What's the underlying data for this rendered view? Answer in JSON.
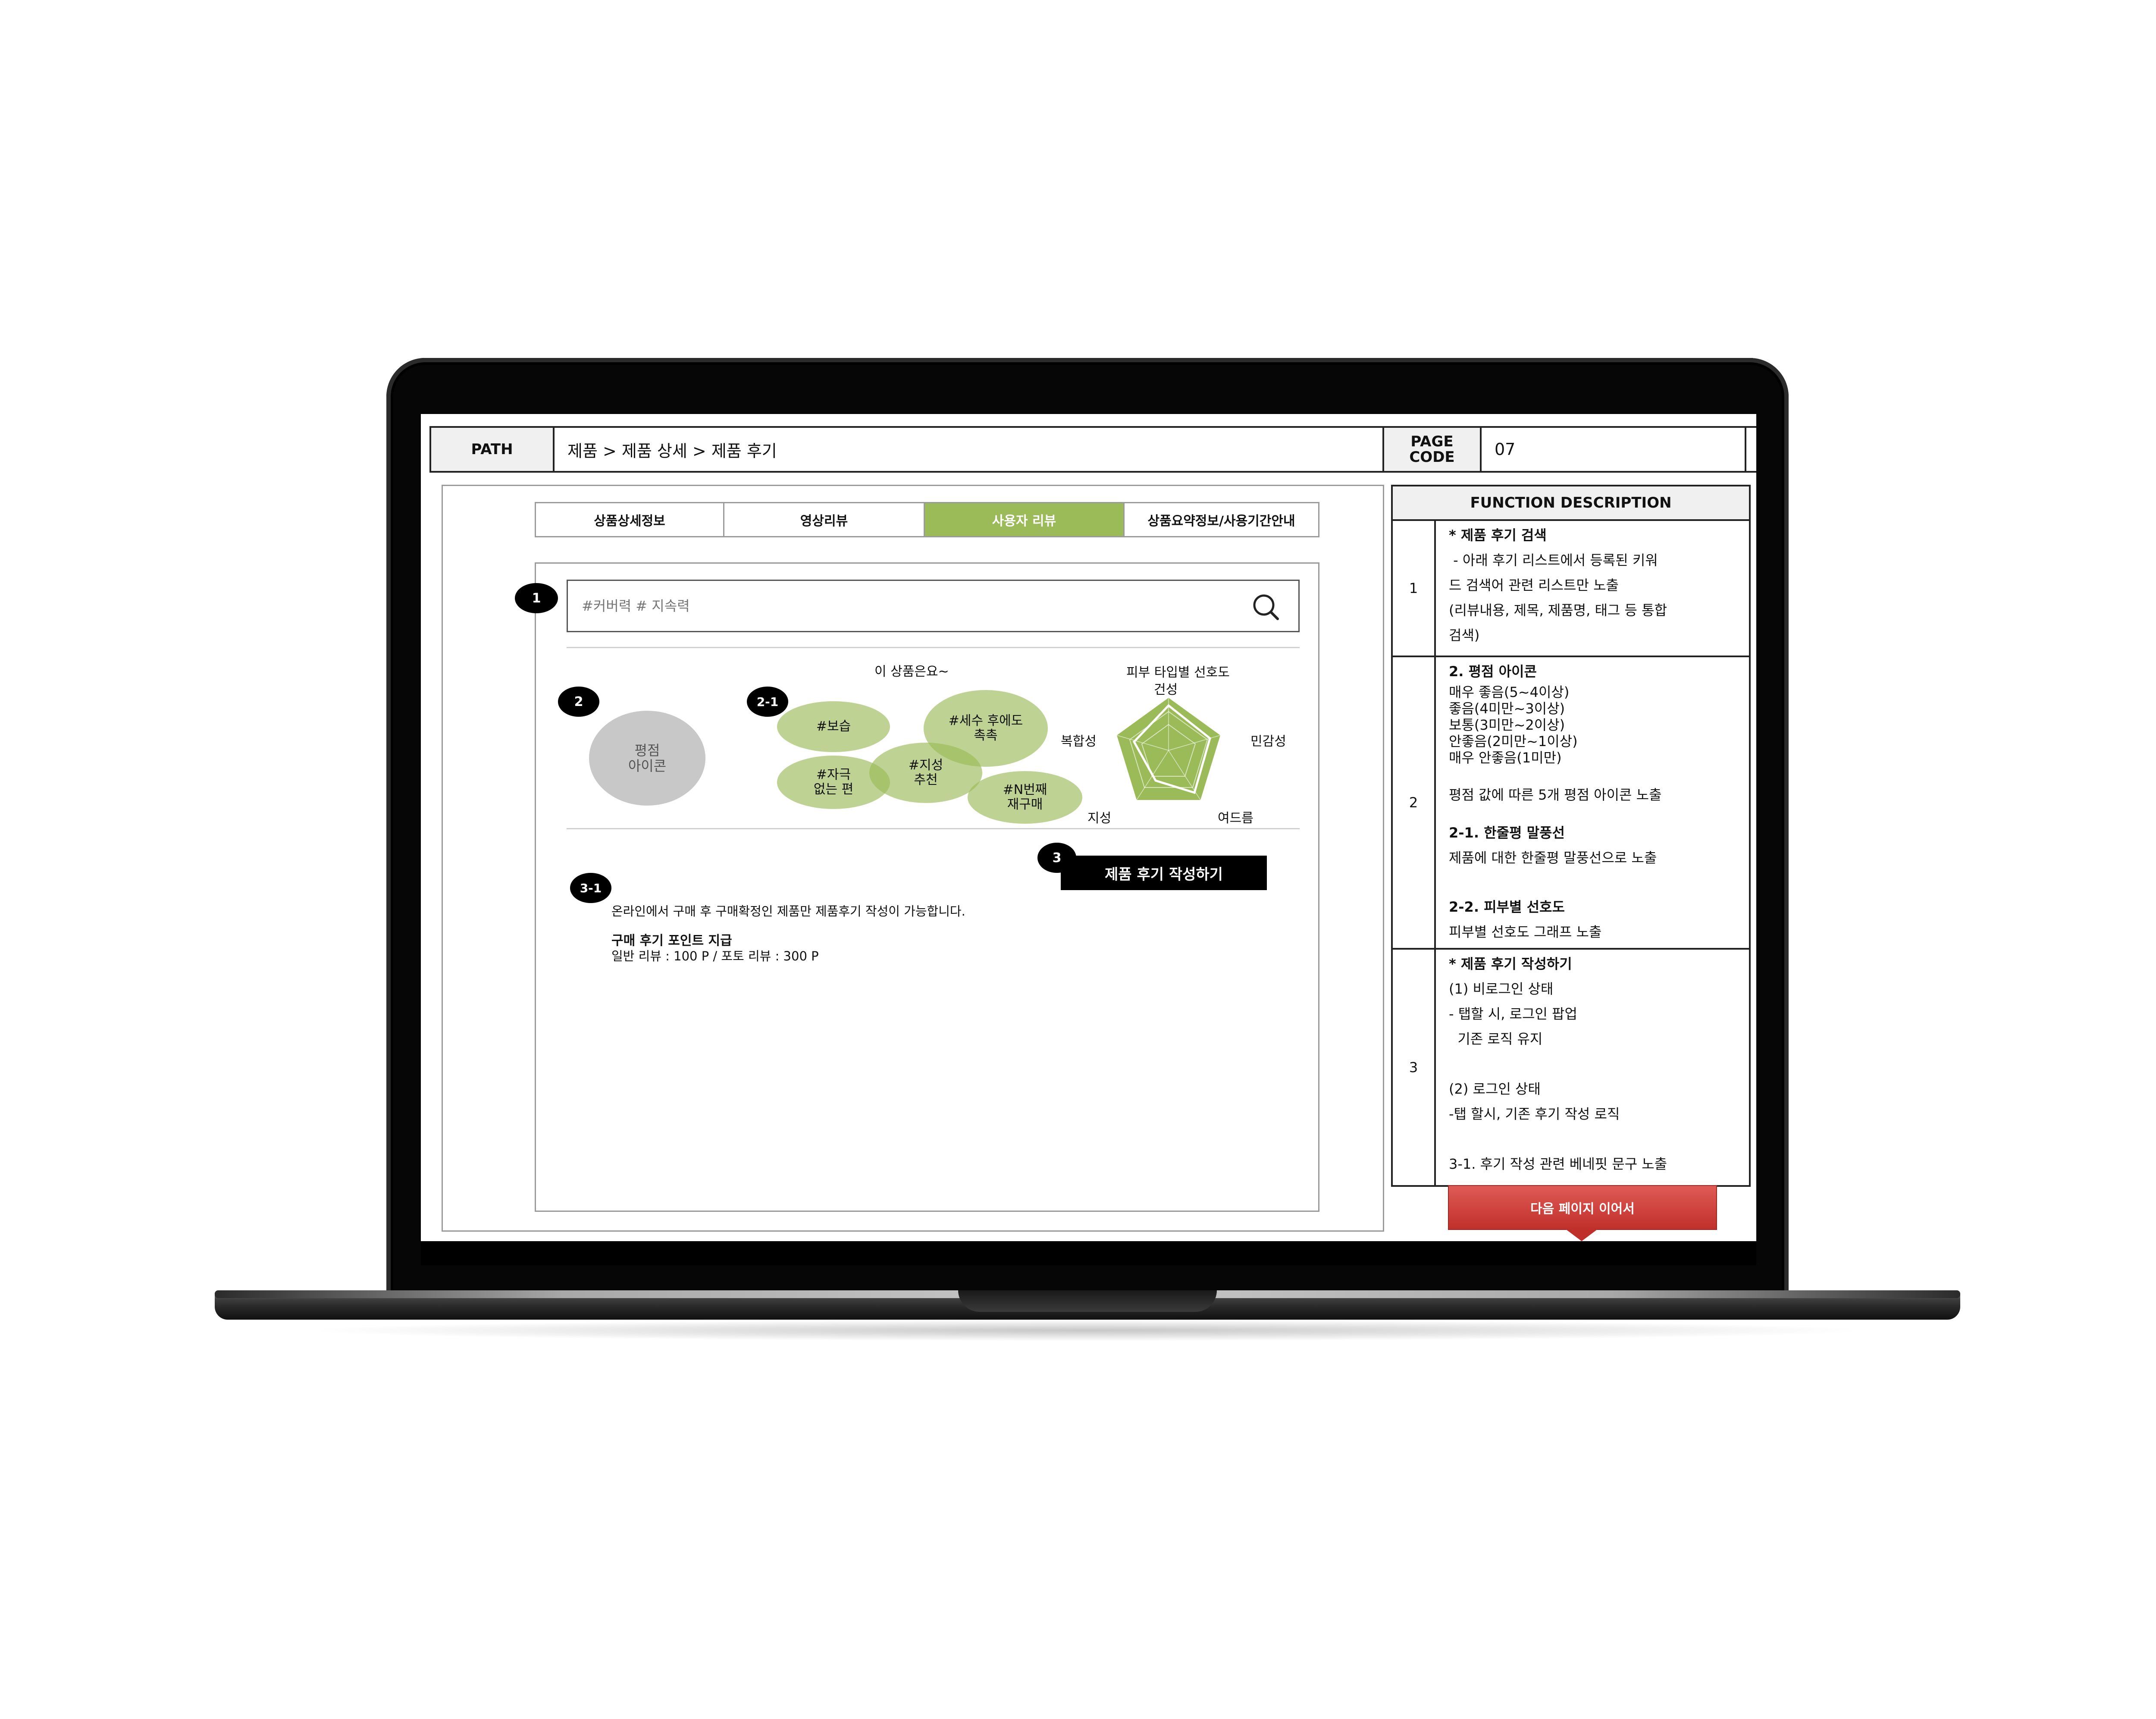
{
  "header": {
    "path_label": "PATH",
    "path_value": "제품 > 제품 상세 > 제품 후기",
    "page_code_label": "PAGE\nCODE",
    "page_code_value": "07"
  },
  "tabs": [
    {
      "label": "상품상세정보"
    },
    {
      "label": "영상리뷰"
    },
    {
      "label": "사용자 리뷰"
    },
    {
      "label": "상품요약정보/사용기간안내"
    }
  ],
  "search": {
    "placeholder": "#커버력 # 지속력",
    "icon": "search-icon"
  },
  "markers": {
    "m1": "1",
    "m2": "2",
    "m2_1": "2-1",
    "m3": "3",
    "m3_1": "3-1"
  },
  "rating_icon": {
    "label": "평점\n아이콘"
  },
  "bubbles": {
    "title": "이 상품은요~",
    "items": [
      {
        "label": "#보습"
      },
      {
        "label": "#세수 후에도\n촉촉"
      },
      {
        "label": "#자극\n없는 편"
      },
      {
        "label": "#지성\n추천"
      },
      {
        "label": "#N번째\n재구매"
      }
    ]
  },
  "radar": {
    "title": "피부 타입별 선호도",
    "axes": [
      "건성",
      "민감성",
      "여드름",
      "지성",
      "복합성"
    ],
    "accent": "#9bbb59"
  },
  "write_review_button": "제품 후기 작성하기",
  "notice": {
    "text": "온라인에서 구매 후 구매확정인 제품만 제품후기 작성이 가능합니다.",
    "points_title": "구매 후기 포인트 지급",
    "points_detail": "일반 리뷰 : 100 P / 포토 리뷰 : 300 P"
  },
  "function_description": {
    "title": "FUNCTION DESCRIPTION",
    "rows": [
      {
        "num": "1",
        "lines": [
          "* 제품 후기 검색",
          " - 아래 후기 리스트에서 등록된 키워",
          "드 검색어 관련 리스트만 노출",
          "(리뷰내용, 제목, 제품명, 태그 등 통합",
          "검색)"
        ]
      },
      {
        "num": "2",
        "head": "2. 평점 아이콘",
        "tight": [
          "매우 좋음(5~4이상)",
          "좋음(4미만~3이상)",
          "보통(3미만~2이상)",
          "안좋음(2미만~1이상)",
          "매우 안좋음(1미만)"
        ],
        "after": "평점 값에 따른 5개 평점 아이콘 노출",
        "sub1_title": "2-1. 한줄평 말풍선",
        "sub1_text": "제품에 대한 한줄평 말풍선으로 노출",
        "sub2_title": "2-2. 피부별 선호도",
        "sub2_text": "피부별 선호도 그래프 노출"
      },
      {
        "num": "3",
        "lines": [
          "* 제품 후기 작성하기",
          "(1) 비로그인 상태",
          "- 탭할 시, 로그인 팝업",
          "  기존 로직 유지",
          "",
          "(2) 로그인 상태",
          "-탭 할시, 기존 후기 작성 로직",
          "",
          "3-1. 후기 작성 관련 베네핏 문구 노출"
        ]
      }
    ]
  },
  "next_page_button": "다음 페이지 이어서"
}
